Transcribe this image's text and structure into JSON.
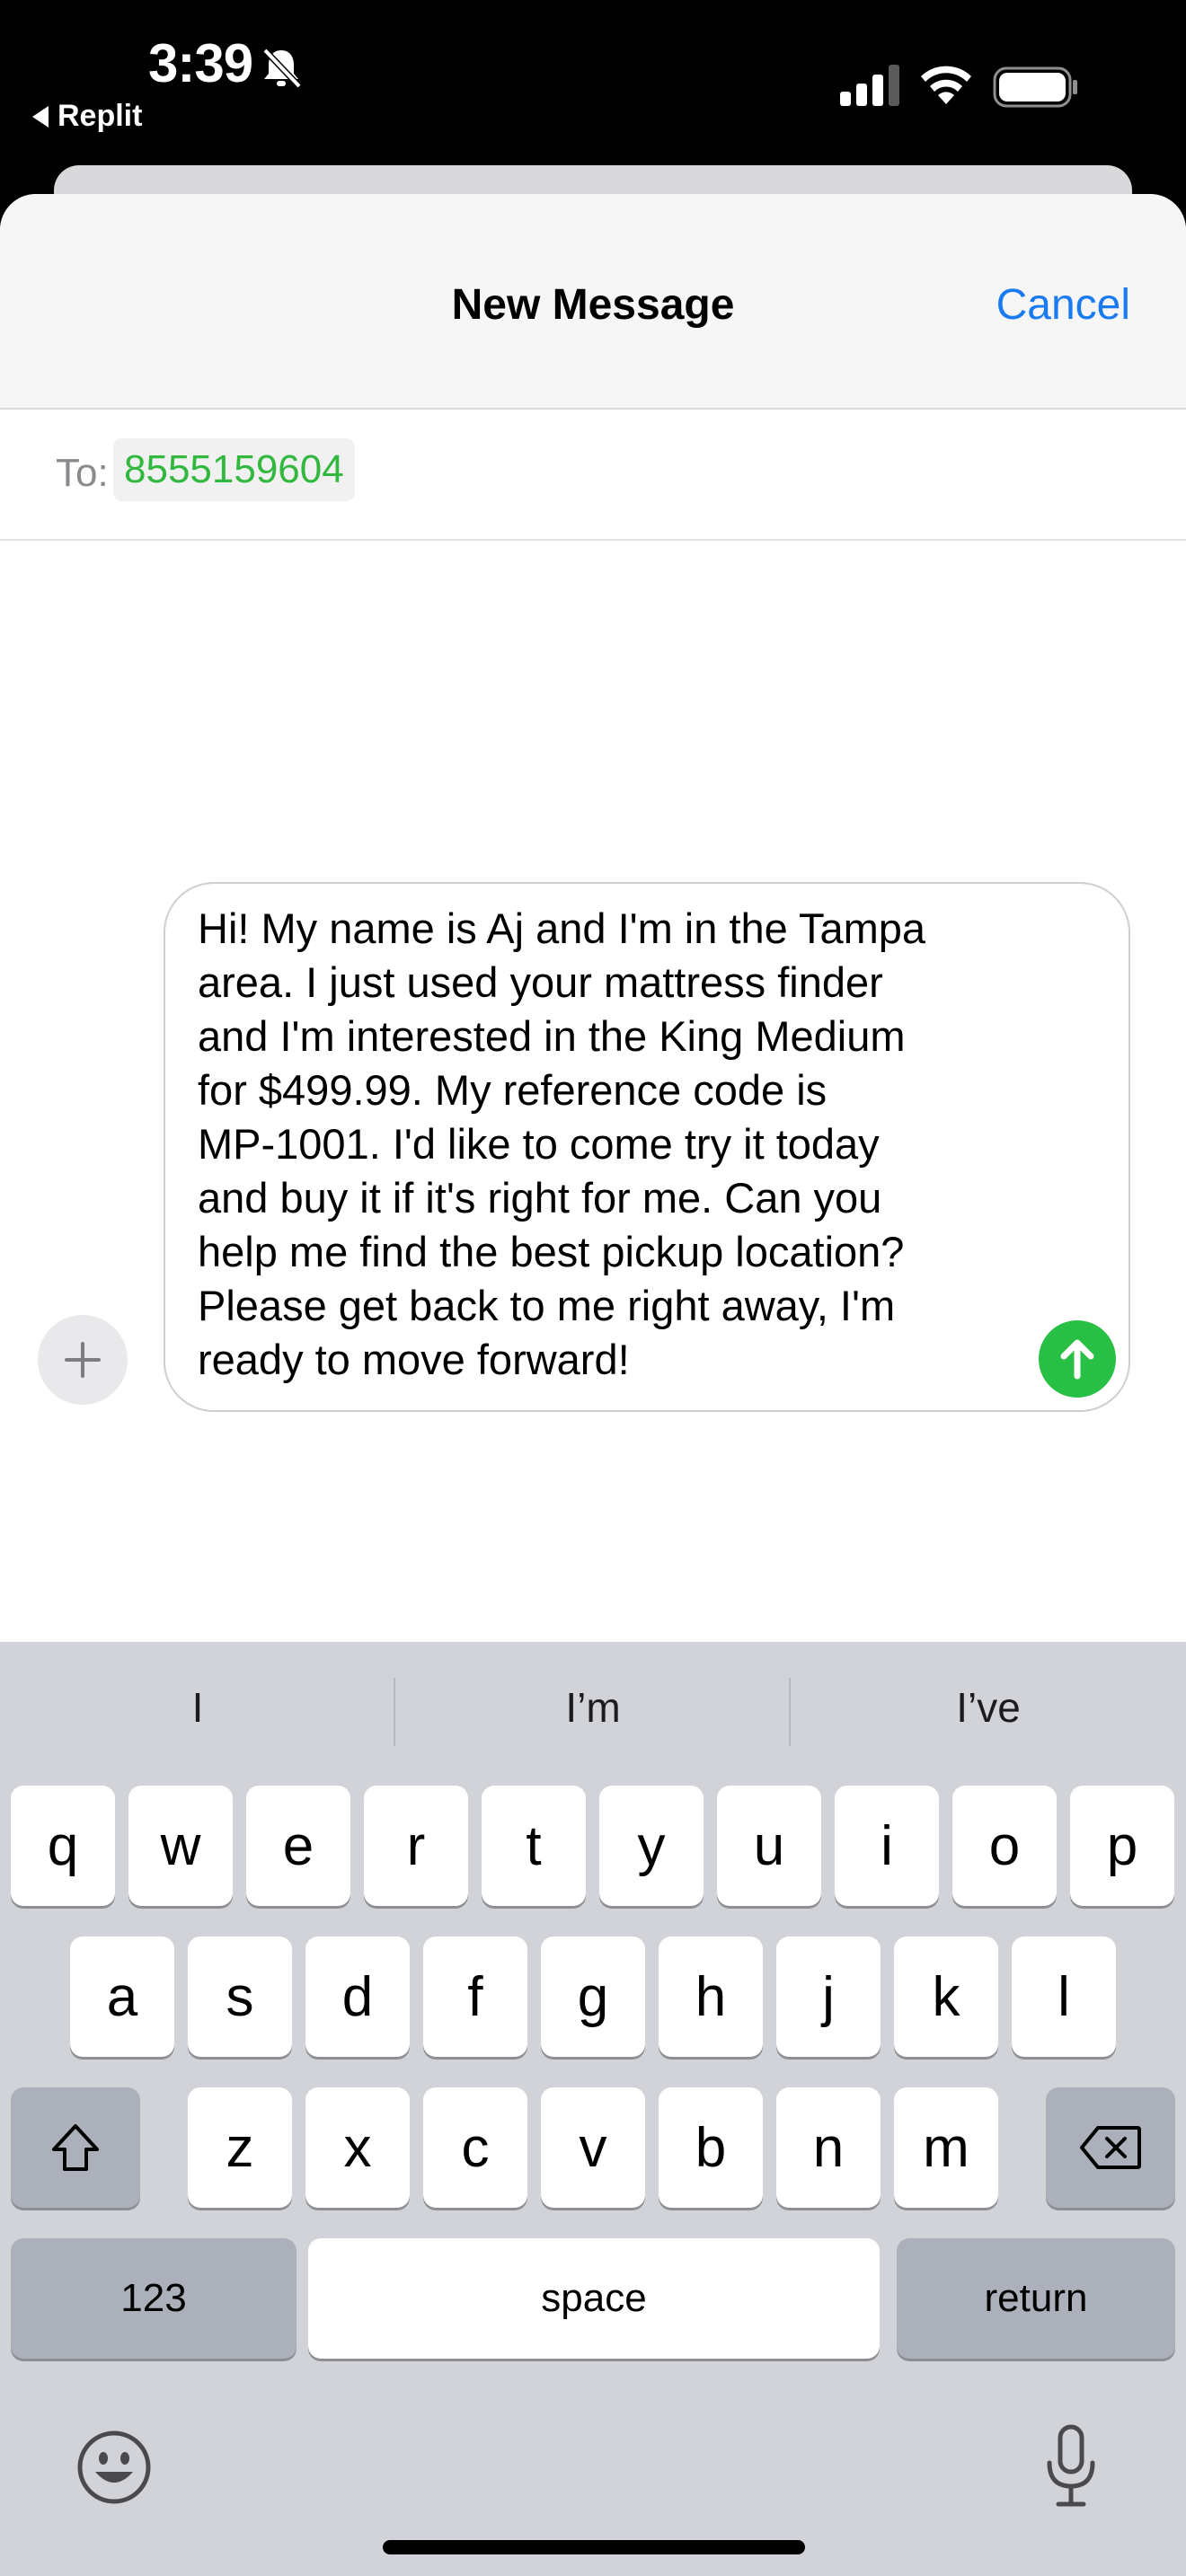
{
  "status_bar": {
    "time": "3:39",
    "back_app": "Replit"
  },
  "header": {
    "title": "New Message",
    "cancel_label": "Cancel"
  },
  "recipient": {
    "to_label": "To:",
    "number": "8555159604"
  },
  "compose": {
    "message": "Hi! My name is Aj and I'm in the Tampa\narea. I just used your mattress finder\nand I'm interested in the King Medium\nfor $499.99. My reference code is\nMP-1001. I'd like to come try it today\nand buy it if it's right for me. Can you\nhelp me find the best pickup location?\nPlease get back to me right away, I'm\nready to move forward!"
  },
  "keyboard": {
    "predictions": [
      "I",
      "I’m",
      "I’ve"
    ],
    "row1": [
      "q",
      "w",
      "e",
      "r",
      "t",
      "y",
      "u",
      "i",
      "o",
      "p"
    ],
    "row2": [
      "a",
      "s",
      "d",
      "f",
      "g",
      "h",
      "j",
      "k",
      "l"
    ],
    "row3": [
      "z",
      "x",
      "c",
      "v",
      "b",
      "n",
      "m"
    ],
    "numbers_label": "123",
    "space_label": "space",
    "return_label": "return"
  },
  "colors": {
    "accent_blue": "#1a7bf0",
    "recipient_green": "#32b83f",
    "send_green": "#27c044",
    "keyboard_bg": "#d1d3d9"
  },
  "icons": [
    "bell-slash-icon",
    "cellular-signal-icon",
    "wifi-icon",
    "battery-icon",
    "plus-icon",
    "send-arrow-icon",
    "shift-icon",
    "delete-icon",
    "emoji-icon",
    "microphone-icon"
  ]
}
